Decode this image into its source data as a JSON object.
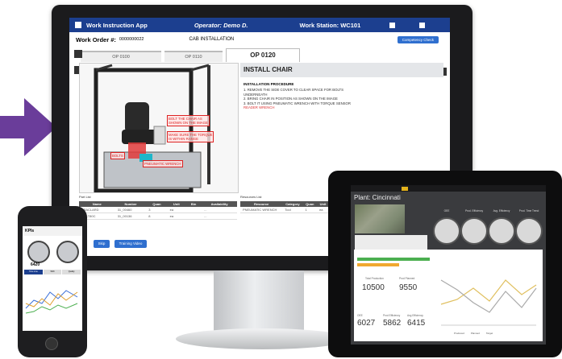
{
  "monitor_app": {
    "app_title": "Work Instruction App",
    "operator": "Operator: Demo D.",
    "work_station": "Work Station: WC101",
    "work_order_label": "Work Order #:",
    "work_order_number": "0000000022",
    "work_order_title": "CAB INSTALLATION",
    "competency_button": "Competency Check",
    "tabs": [
      "OP 0100",
      "OP 0110",
      "OP 0120"
    ],
    "active_tab": "OP 0120",
    "instruction_title": "INSTALL CHAIR",
    "procedure_heading": "INSTALLATION PROCEDURE",
    "procedure_lines": [
      "1. REMOVE THE SIDE COVER TO CLEAR SPACE FOR BOLTS",
      "UNDERNEATH",
      "2. BRING CHAIR IN POSITION AS SHOWN ON THE IMAGE",
      "3. BOLT IT USING PNEUMATIC WRENCH WITH TORQUE SENSOR"
    ],
    "procedure_red": "READER WRENCH",
    "callouts": {
      "chair_a": "BOLT THE CHAIR AS",
      "chair_b": "SHOWN ON THE IMAGE",
      "torque_a": "MAKE SURE THE TORQUE",
      "torque_b": "IS WITHIN RANGE",
      "bolts": "BOLTS",
      "wrench": "PNEUMATIC WRENCH"
    },
    "part_list_caption": "Part List",
    "part_table": {
      "headers": [
        "Name",
        "Number",
        "Quan",
        "Unit",
        "Bin",
        "Availability"
      ],
      "rows": [
        [
          "TRACLARD",
          "31_00460",
          "3",
          "ea",
          "",
          "..."
        ],
        [
          "BOLT80C",
          "31_00136",
          "8",
          "ea",
          "",
          "..."
        ]
      ]
    },
    "resources_caption": "Resources List",
    "resource_table": {
      "headers": [
        "Resource",
        "Category",
        "Quan",
        "Unit"
      ],
      "rows": [
        [
          "PNEUMATIC WRENCH",
          "Tool",
          "1",
          "ea"
        ]
      ]
    },
    "buttons": [
      "Skip",
      "Training Video"
    ]
  },
  "tablet_app": {
    "plant": "Plant: Cincinnati",
    "gauges": [
      "OEE",
      "Prod. Efficiency",
      "Avg. Efficiency",
      "Prod. Time Trend"
    ],
    "production_label": "Total Production",
    "production_value": "10500",
    "planned_label": "Prod Planned",
    "planned_value": "9550",
    "oee_label": "OEE",
    "oee_value": "6027",
    "eff_label": "Prod Efficiency",
    "eff_value": "5862",
    "avg_label": "Avg Efficiency",
    "avg_value": "6415",
    "chart_legend": [
      "Produced",
      "Planned",
      "Target"
    ]
  },
  "phone_app": {
    "title": "KPIs",
    "kpi_value": "6420",
    "tabs": [
      "Time Line",
      "Shift",
      "Quality"
    ]
  },
  "colors": {
    "app_bar": "#1c3f8f",
    "accent_red": "#d33333",
    "arrow": "#6a3d9a",
    "button_blue": "#2f6fcf"
  }
}
